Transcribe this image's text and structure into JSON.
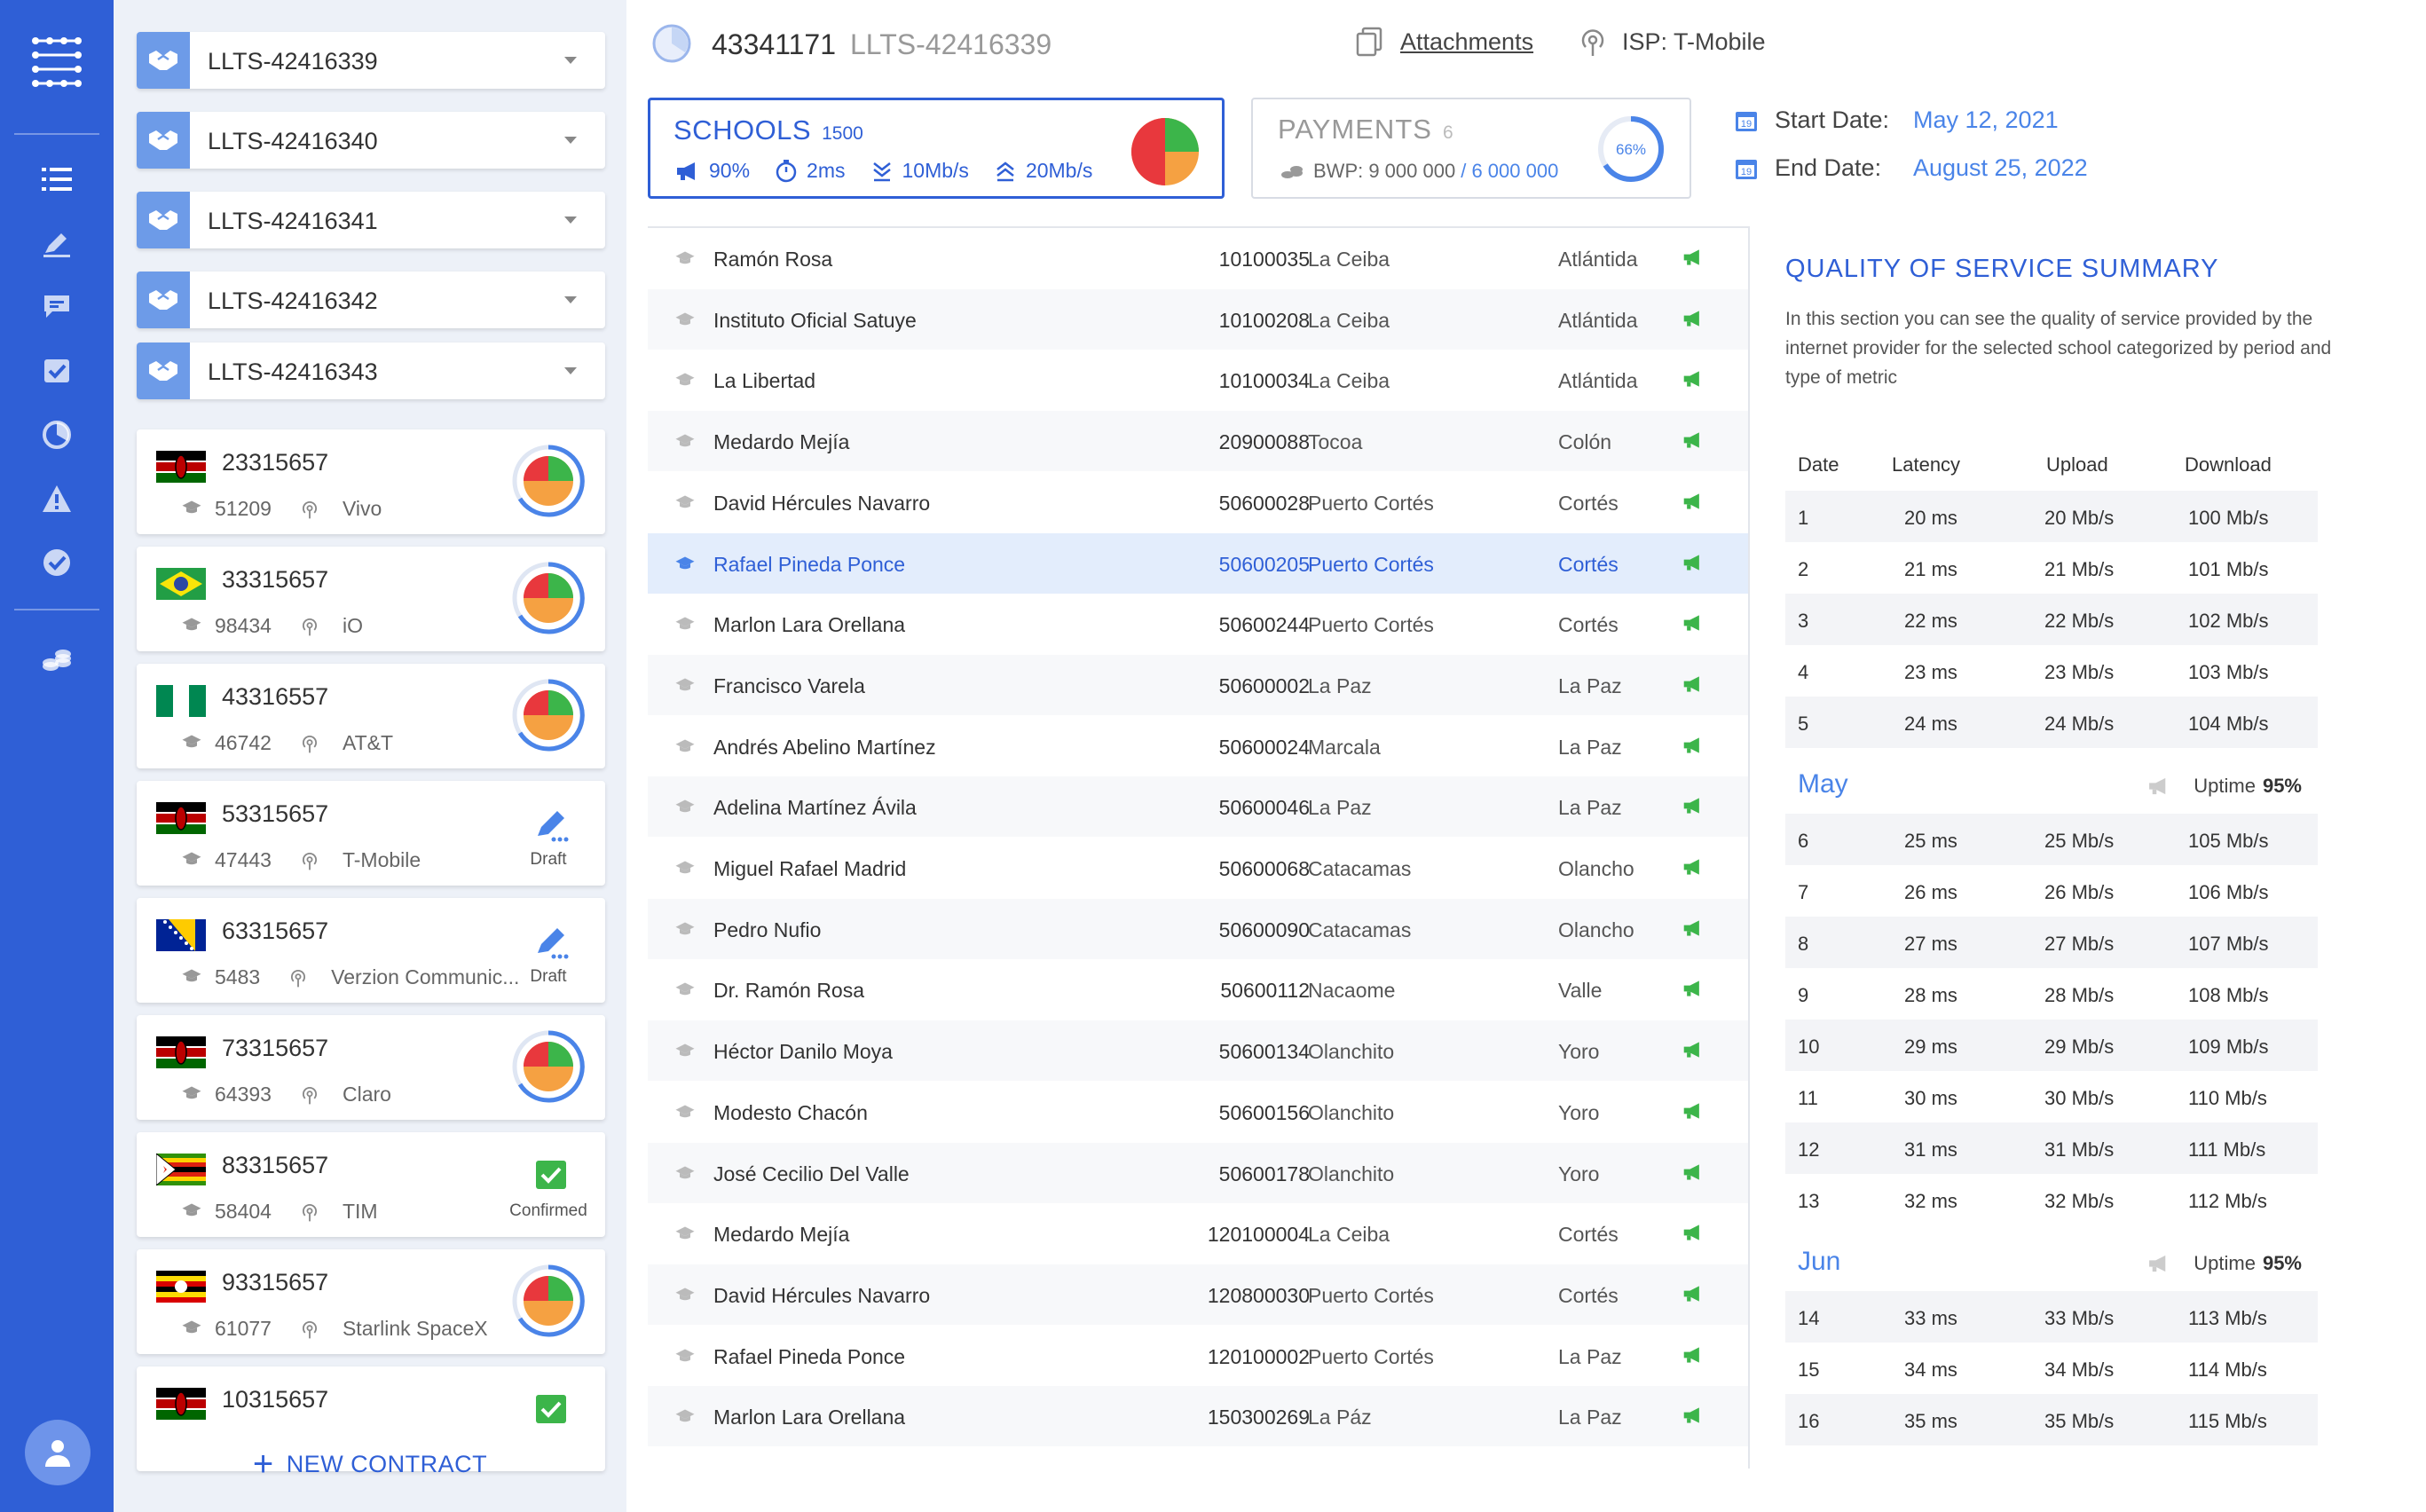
{
  "contract_selectors": [
    {
      "label": "LLTS-42416339"
    },
    {
      "label": "LLTS-42416340"
    },
    {
      "label": "LLTS-42416341"
    },
    {
      "label": "LLTS-42416342"
    },
    {
      "label": "LLTS-42416343"
    }
  ],
  "contracts": [
    {
      "id": "23315657",
      "schools": "51209",
      "isp": "Vivo",
      "flag": "kenya",
      "status": "pie",
      "status_label": ""
    },
    {
      "id": "33315657",
      "schools": "98434",
      "isp": "iO",
      "flag": "brazil",
      "status": "pie",
      "status_label": ""
    },
    {
      "id": "43316557",
      "schools": "46742",
      "isp": "AT&T",
      "flag": "nigeria",
      "status": "pie",
      "status_label": ""
    },
    {
      "id": "53315657",
      "schools": "47443",
      "isp": "T-Mobile",
      "flag": "kenya",
      "status": "draft",
      "status_label": "Draft"
    },
    {
      "id": "63315657",
      "schools": "5483",
      "isp": "Verzion Communic...",
      "flag": "bosnia",
      "status": "draft",
      "status_label": "Draft"
    },
    {
      "id": "73315657",
      "schools": "64393",
      "isp": "Claro",
      "flag": "kenya",
      "status": "pie",
      "status_label": ""
    },
    {
      "id": "83315657",
      "schools": "58404",
      "isp": "TIM",
      "flag": "zimbabwe",
      "status": "confirmed",
      "status_label": "Confirmed"
    },
    {
      "id": "93315657",
      "schools": "61077",
      "isp": "Starlink SpaceX",
      "flag": "uganda",
      "status": "pie",
      "status_label": ""
    },
    {
      "id": "10315657",
      "schools": "",
      "isp": "",
      "flag": "kenya",
      "status": "confirmed",
      "status_label": ""
    }
  ],
  "new_contract_label": "NEW CONTRACT",
  "header": {
    "contract_id": "43341171",
    "contract_code": "LLTS-42416339",
    "attachments_label": "Attachments",
    "isp_label": "ISP: T-Mobile"
  },
  "schools_box": {
    "title": "SCHOOLS",
    "count": "1500",
    "uptime": "90%",
    "latency": "2ms",
    "upload": "10Mb/s",
    "download": "20Mb/s"
  },
  "payments_box": {
    "title": "PAYMENTS",
    "count": "6",
    "amount": "BWP: 9 000 000",
    "total": "/ 6 000 000",
    "percent": "66%",
    "percent_value": 0.66
  },
  "dates": {
    "start_label": "Start Date:",
    "start_value": "May 12, 2021",
    "end_label": "End Date:",
    "end_value": "August 25, 2022"
  },
  "schools": [
    {
      "name": "Ramón Rosa",
      "code": "10100035",
      "city": "La Ceiba",
      "province": "Atlántida"
    },
    {
      "name": "Instituto Oficial Satuye",
      "code": "10100208",
      "city": "La Ceiba",
      "province": "Atlántida"
    },
    {
      "name": "La Libertad",
      "code": "10100034",
      "city": "La Ceiba",
      "province": "Atlántida"
    },
    {
      "name": "Medardo Mejía",
      "code": "20900088",
      "city": "Tocoa",
      "province": "Colón"
    },
    {
      "name": "David Hércules Navarro",
      "code": "50600028",
      "city": "Puerto Cortés",
      "province": "Cortés"
    },
    {
      "name": "Rafael Pineda Ponce",
      "code": "50600205",
      "city": "Puerto Cortés",
      "province": "Cortés",
      "selected": true
    },
    {
      "name": "Marlon Lara Orellana",
      "code": "50600244",
      "city": "Puerto Cortés",
      "province": "Cortés"
    },
    {
      "name": "Francisco Varela",
      "code": "50600002",
      "city": "La Paz",
      "province": "La Paz"
    },
    {
      "name": "Andrés Abelino Martínez",
      "code": "50600024",
      "city": "Marcala",
      "province": "La Paz"
    },
    {
      "name": "Adelina Martínez Ávila",
      "code": "50600046",
      "city": "La Paz",
      "province": "La Paz"
    },
    {
      "name": "Miguel Rafael Madrid",
      "code": "50600068",
      "city": "Catacamas",
      "province": "Olancho"
    },
    {
      "name": "Pedro Nufio",
      "code": "50600090",
      "city": "Catacamas",
      "province": "Olancho"
    },
    {
      "name": "Dr. Ramón Rosa",
      "code": "50600112",
      "city": "Nacaome",
      "province": "Valle"
    },
    {
      "name": "Héctor Danilo Moya",
      "code": "50600134",
      "city": "Olanchito",
      "province": "Yoro"
    },
    {
      "name": "Modesto Chacón",
      "code": "50600156",
      "city": "Olanchito",
      "province": "Yoro"
    },
    {
      "name": "José Cecilio Del Valle",
      "code": "50600178",
      "city": "Olanchito",
      "province": "Yoro"
    },
    {
      "name": "Medardo Mejía",
      "code": "120100004",
      "city": "La Ceiba",
      "province": "Cortés"
    },
    {
      "name": "David Hércules Navarro",
      "code": "120800030",
      "city": "Puerto Cortés",
      "province": "Cortés"
    },
    {
      "name": "Rafael Pineda Ponce",
      "code": "120100002",
      "city": "Puerto Cortés",
      "province": "La Paz"
    },
    {
      "name": "Marlon Lara Orellana",
      "code": "150300269",
      "city": "La Páz",
      "province": "La Paz"
    }
  ],
  "qos": {
    "title": "QUALITY OF SERVICE SUMMARY",
    "description": "In this section you can see the quality of service provided by the internet provider for the selected school categorized by period and type of metric",
    "headers": [
      "Date",
      "Latency",
      "Upload",
      "Download"
    ],
    "uptime_label": "Uptime",
    "groups": [
      {
        "month": "",
        "uptime": "",
        "rows": [
          [
            "1",
            "20 ms",
            "20 Mb/s",
            "100 Mb/s"
          ],
          [
            "2",
            "21 ms",
            "21 Mb/s",
            "101 Mb/s"
          ],
          [
            "3",
            "22 ms",
            "22 Mb/s",
            "102 Mb/s"
          ],
          [
            "4",
            "23 ms",
            "23 Mb/s",
            "103 Mb/s"
          ],
          [
            "5",
            "24 ms",
            "24 Mb/s",
            "104 Mb/s"
          ]
        ]
      },
      {
        "month": "May",
        "uptime": "95%",
        "rows": [
          [
            "6",
            "25 ms",
            "25 Mb/s",
            "105 Mb/s"
          ],
          [
            "7",
            "26 ms",
            "26 Mb/s",
            "106 Mb/s"
          ],
          [
            "8",
            "27 ms",
            "27 Mb/s",
            "107 Mb/s"
          ],
          [
            "9",
            "28 ms",
            "28 Mb/s",
            "108 Mb/s"
          ],
          [
            "10",
            "29 ms",
            "29 Mb/s",
            "109 Mb/s"
          ],
          [
            "11",
            "30 ms",
            "30 Mb/s",
            "110 Mb/s"
          ],
          [
            "12",
            "31 ms",
            "31 Mb/s",
            "111 Mb/s"
          ],
          [
            "13",
            "32 ms",
            "32 Mb/s",
            "112 Mb/s"
          ]
        ]
      },
      {
        "month": "Jun",
        "uptime": "95%",
        "rows": [
          [
            "14",
            "33 ms",
            "33 Mb/s",
            "113 Mb/s"
          ],
          [
            "15",
            "34 ms",
            "34 Mb/s",
            "114 Mb/s"
          ],
          [
            "16",
            "35 ms",
            "35 Mb/s",
            "115 Mb/s"
          ]
        ]
      }
    ]
  },
  "colors": {
    "brand": "#2f5fd6",
    "accent": "#4a84e8",
    "panel": "#edf1f8",
    "green": "#3cb54a",
    "orange": "#f5a142",
    "red": "#e8383d"
  },
  "rail_icons": [
    "list-icon",
    "edit-icon",
    "chat-icon",
    "check-box-icon",
    "pie-chart-icon",
    "warning-icon",
    "check-circle-icon",
    "coins-icon"
  ]
}
